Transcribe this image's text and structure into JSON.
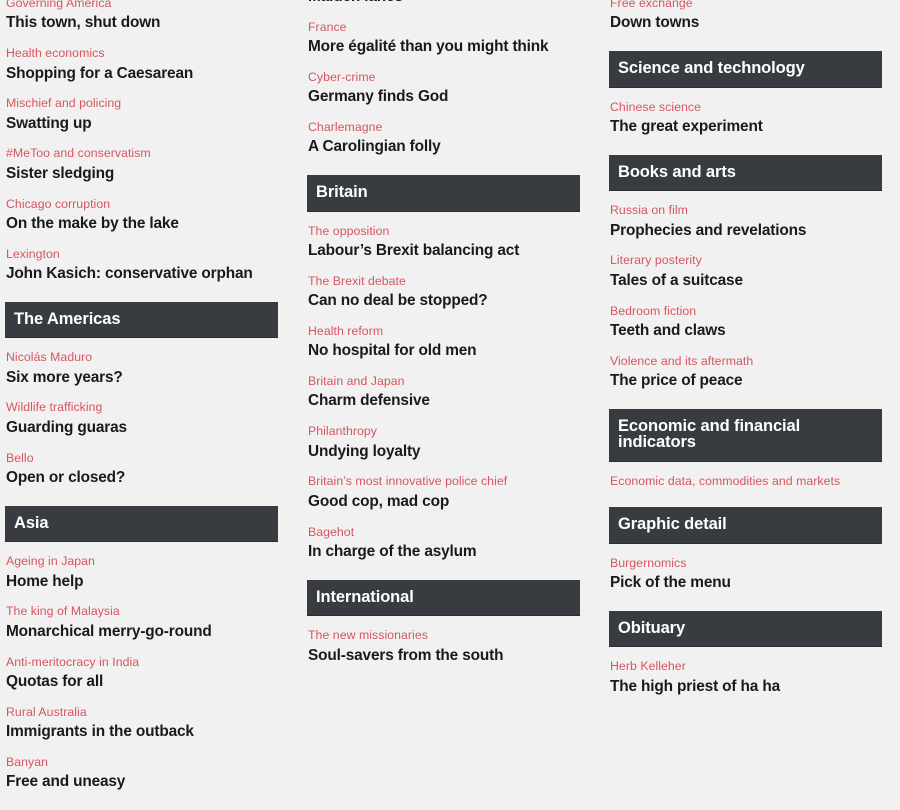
{
  "theme": {
    "background": "#f1f1f1",
    "header_bar": "#383c41",
    "header_text": "#ffffff",
    "kicker_color": "#d6565f",
    "headline_color": "#1a1a1a"
  },
  "columns": [
    {
      "id": "column-1",
      "sections": [
        {
          "id": "section-united-states-continued",
          "header": null,
          "articles": [
            {
              "kicker": "Governing America",
              "headline": "This town, shut down"
            },
            {
              "kicker": "Health economics",
              "headline": "Shopping for a Caesarean"
            },
            {
              "kicker": "Mischief and policing",
              "headline": "Swatting up"
            },
            {
              "kicker": "#MeToo and conservatism",
              "headline": "Sister sledging"
            },
            {
              "kicker": "Chicago corruption",
              "headline": "On the make by the lake"
            },
            {
              "kicker": "Lexington",
              "headline": "John Kasich: conservative orphan"
            }
          ]
        },
        {
          "id": "section-the-americas",
          "header": "The Americas",
          "articles": [
            {
              "kicker": "Nicolás Maduro",
              "headline": "Six more years?"
            },
            {
              "kicker": "Wildlife trafficking",
              "headline": "Guarding guaras"
            },
            {
              "kicker": "Bello",
              "headline": "Open or closed?"
            }
          ]
        },
        {
          "id": "section-asia",
          "header": "Asia",
          "articles": [
            {
              "kicker": "Ageing in Japan",
              "headline": "Home help"
            },
            {
              "kicker": "The king of Malaysia",
              "headline": "Monarchical merry-go-round"
            },
            {
              "kicker": "Anti-meritocracy in India",
              "headline": "Quotas for all"
            },
            {
              "kicker": "Rural Australia",
              "headline": "Immigrants in the outback"
            },
            {
              "kicker": "Banyan",
              "headline": "Free and uneasy"
            }
          ]
        }
      ]
    },
    {
      "id": "column-2",
      "sections": [
        {
          "id": "section-europe-continued",
          "header": null,
          "articles": [
            {
              "kicker": null,
              "headline": "Maiden lanes"
            },
            {
              "kicker": "France",
              "headline": "More égalité than you might think"
            },
            {
              "kicker": "Cyber-crime",
              "headline": "Germany finds God"
            },
            {
              "kicker": "Charlemagne",
              "headline": "A Carolingian folly"
            }
          ]
        },
        {
          "id": "section-britain",
          "header": "Britain",
          "articles": [
            {
              "kicker": "The opposition",
              "headline": "Labour’s Brexit balancing act"
            },
            {
              "kicker": "The Brexit debate",
              "headline": "Can no deal be stopped?"
            },
            {
              "kicker": "Health reform",
              "headline": "No hospital for old men"
            },
            {
              "kicker": "Britain and Japan",
              "headline": "Charm defensive"
            },
            {
              "kicker": "Philanthropy",
              "headline": "Undying loyalty"
            },
            {
              "kicker": "Britain’s most innovative police chief",
              "headline": "Good cop, mad cop"
            },
            {
              "kicker": "Bagehot",
              "headline": "In charge of the asylum"
            }
          ]
        },
        {
          "id": "section-international",
          "header": "International",
          "articles": [
            {
              "kicker": "The new missionaries",
              "headline": "Soul-savers from the south"
            }
          ]
        }
      ]
    },
    {
      "id": "column-3",
      "sections": [
        {
          "id": "section-finance-continued",
          "header": null,
          "articles": [
            {
              "kicker": "Free exchange",
              "headline": "Down towns"
            }
          ]
        },
        {
          "id": "section-science-and-technology",
          "header": "Science and technology",
          "articles": [
            {
              "kicker": "Chinese science",
              "headline": "The great experiment"
            }
          ]
        },
        {
          "id": "section-books-and-arts",
          "header": "Books and arts",
          "articles": [
            {
              "kicker": "Russia on film",
              "headline": "Prophecies and revelations"
            },
            {
              "kicker": "Literary posterity",
              "headline": "Tales of a suitcase"
            },
            {
              "kicker": "Bedroom fiction",
              "headline": "Teeth and claws"
            },
            {
              "kicker": "Violence and its aftermath",
              "headline": "The price of peace"
            }
          ]
        },
        {
          "id": "section-economic-and-financial-indicators",
          "header": "Economic and financial indicators",
          "articles": [
            {
              "kicker": "Economic data, commodities and markets",
              "headline": null
            }
          ]
        },
        {
          "id": "section-graphic-detail",
          "header": "Graphic detail",
          "articles": [
            {
              "kicker": "Burgernomics",
              "headline": "Pick of the menu"
            }
          ]
        },
        {
          "id": "section-obituary",
          "header": "Obituary",
          "articles": [
            {
              "kicker": "Herb Kelleher",
              "headline": "The high priest of ha ha"
            }
          ]
        }
      ]
    }
  ]
}
